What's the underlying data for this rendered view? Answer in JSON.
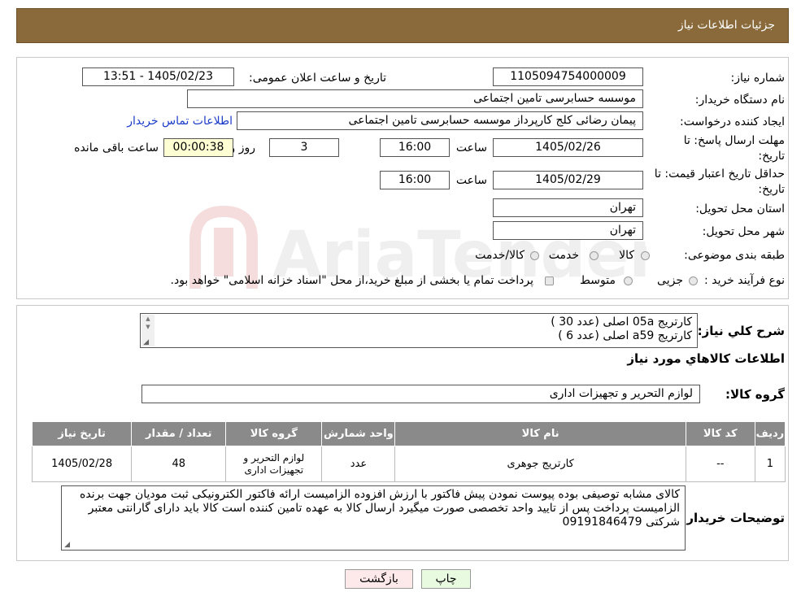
{
  "header": {
    "title": "جزئیات اطلاعات نیاز"
  },
  "fields": {
    "need_number_label": "شماره نیاز:",
    "need_number": "1105094754000009",
    "announce_label": "تاریخ و ساعت اعلان عمومی:",
    "announce_value": "1405/02/23 - 13:51",
    "buyer_label": "نام دستگاه خریدار:",
    "buyer_value": "موسسه حسابرسی تامین اجتماعی",
    "creator_label": "ایجاد کننده درخواست:",
    "creator_value": "پیمان رضائی کلج کارپرداز موسسه حسابرسی تامین اجتماعی",
    "contact_link": "اطلاعات تماس خریدار",
    "deadline_label_1": "مهلت ارسال پاسخ: تا",
    "deadline_label_2": "تاریخ:",
    "deadline_date": "1405/02/26",
    "time_label": "ساعت",
    "deadline_time": "16:00",
    "days_value": "3",
    "days_label": "روز و",
    "remaining_time": "00:00:38",
    "remaining_label": "ساعت باقی مانده",
    "validity_label_1": "حداقل تاریخ اعتبار قیمت: تا",
    "validity_label_2": "تاریخ:",
    "validity_date": "1405/02/29",
    "validity_time": "16:00",
    "province_label": "استان محل تحویل:",
    "province_value": "تهران",
    "city_label": "شهر محل تحویل:",
    "city_value": "تهران",
    "category_label": "طبقه بندی موضوعی:",
    "category_options": [
      "کالا",
      "خدمت",
      "کالا/خدمت"
    ],
    "process_label": "نوع فرآیند خرید :",
    "process_options": [
      "جزیی",
      "متوسط"
    ],
    "process_note": "پرداخت تمام یا بخشی از مبلغ خرید،از محل \"اسناد خزانه اسلامی\" خواهد بود."
  },
  "summary": {
    "label": "شرح کلي نياز:",
    "line1": "کارتریج 05a اصلی  (عدد 30 )",
    "line2": "کارتریج a59 اصلی (عدد  6 )"
  },
  "goods_title": "اطلاعات کالاهاي مورد نياز",
  "goods_group": {
    "label": "گروه کالا:",
    "value": "لوازم التحریر و تجهیزات اداری"
  },
  "table": {
    "headers": [
      "رديف",
      "کد کالا",
      "نام کالا",
      "واحد شمارش",
      "گروه کالا",
      "تعداد / مقدار",
      "تاريخ نياز"
    ],
    "rows": [
      [
        "1",
        "--",
        "کارتریج جوهری",
        "عدد",
        "لوازم التحرير و تجهيزات اداری",
        "48",
        "1405/02/28"
      ]
    ]
  },
  "buyer_notes": {
    "label": "توضيحات خريدار:",
    "text": "کالای مشابه توصیفی بوده پیوست نمودن پیش فاکتور با ارزش افزوده الزامیست ارائه فاکتور الکترونیکی ثبت مودیان جهت برنده الزامیست پرداخت پس از تایید واحد تخصصی صورت میگیرد ارسال کالا به عهده تامین کننده است کالا باید دارای گارانتی معتبر شرکتی 09191846479"
  },
  "buttons": {
    "print": "چاپ",
    "back": "بازگشت"
  },
  "colors": {
    "header_bg": "#8a6a3a",
    "table_header_bg": "#8a8a8a",
    "timer_bg": "#ffffd4",
    "print_bg": "#e8fbe0",
    "back_bg": "#fde8ea"
  },
  "watermark_icon": "ariatender-logo"
}
